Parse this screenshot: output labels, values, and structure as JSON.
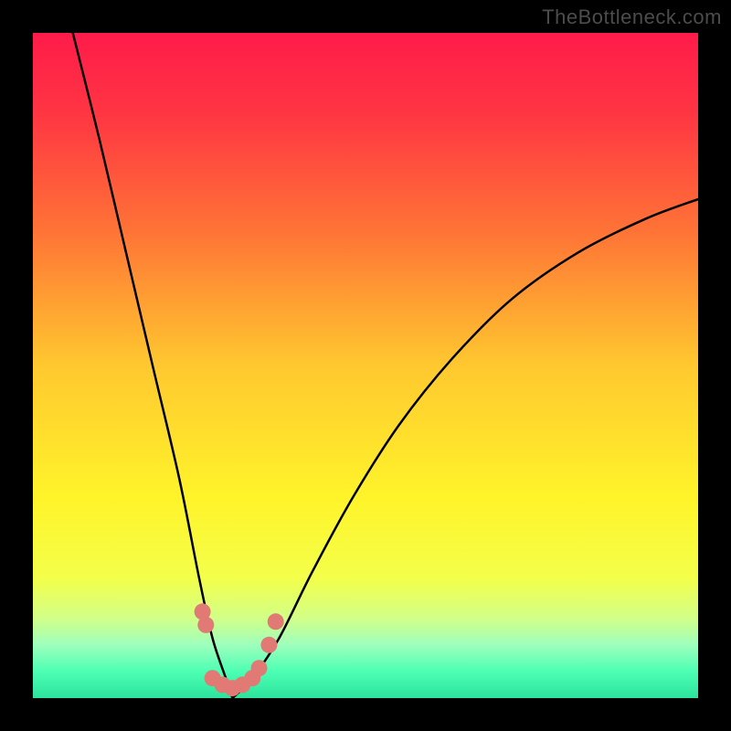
{
  "watermark": "TheBottleneck.com",
  "colors": {
    "background": "#000000",
    "gradient_stops": [
      {
        "offset": 0.0,
        "color": "#ff1b4a"
      },
      {
        "offset": 0.12,
        "color": "#ff3543"
      },
      {
        "offset": 0.3,
        "color": "#ff7436"
      },
      {
        "offset": 0.5,
        "color": "#ffc82f"
      },
      {
        "offset": 0.7,
        "color": "#fff42a"
      },
      {
        "offset": 0.82,
        "color": "#f3ff4a"
      },
      {
        "offset": 0.88,
        "color": "#d2ff88"
      },
      {
        "offset": 0.92,
        "color": "#9effbd"
      },
      {
        "offset": 0.96,
        "color": "#4cffb3"
      },
      {
        "offset": 1.0,
        "color": "#2ce39d"
      }
    ],
    "curve": "#000000",
    "marker": "#e17a74"
  },
  "chart_data": {
    "type": "line",
    "title": "",
    "xlabel": "",
    "ylabel": "",
    "xlim": [
      0,
      100
    ],
    "ylim": [
      0,
      100
    ],
    "note": "Bottleneck-style V-curve. x is left→right 0–100, y is the curve height as percent of plot height (100=top, 0=bottom). Minimum (optimal match) at x≈30.",
    "series": [
      {
        "name": "left-branch",
        "x": [
          6,
          10,
          14,
          18,
          22,
          25,
          27,
          29,
          30
        ],
        "y": [
          100,
          84,
          67,
          50,
          33,
          18,
          9,
          3,
          0
        ]
      },
      {
        "name": "right-branch",
        "x": [
          30,
          33,
          37,
          42,
          48,
          55,
          63,
          72,
          82,
          92,
          100
        ],
        "y": [
          0,
          3,
          9,
          19,
          30,
          41,
          51,
          60,
          67,
          72,
          75
        ]
      }
    ],
    "markers": {
      "name": "dots",
      "note": "Salmon dots clustered near the curve minimum",
      "points": [
        {
          "x": 25.5,
          "y": 13.0
        },
        {
          "x": 26.0,
          "y": 11.0
        },
        {
          "x": 27.0,
          "y": 3.0
        },
        {
          "x": 28.5,
          "y": 2.0
        },
        {
          "x": 30.0,
          "y": 1.5
        },
        {
          "x": 31.5,
          "y": 2.0
        },
        {
          "x": 33.0,
          "y": 3.0
        },
        {
          "x": 34.0,
          "y": 4.5
        },
        {
          "x": 35.5,
          "y": 8.0
        },
        {
          "x": 36.5,
          "y": 11.5
        }
      ],
      "radius_px": 9
    }
  }
}
